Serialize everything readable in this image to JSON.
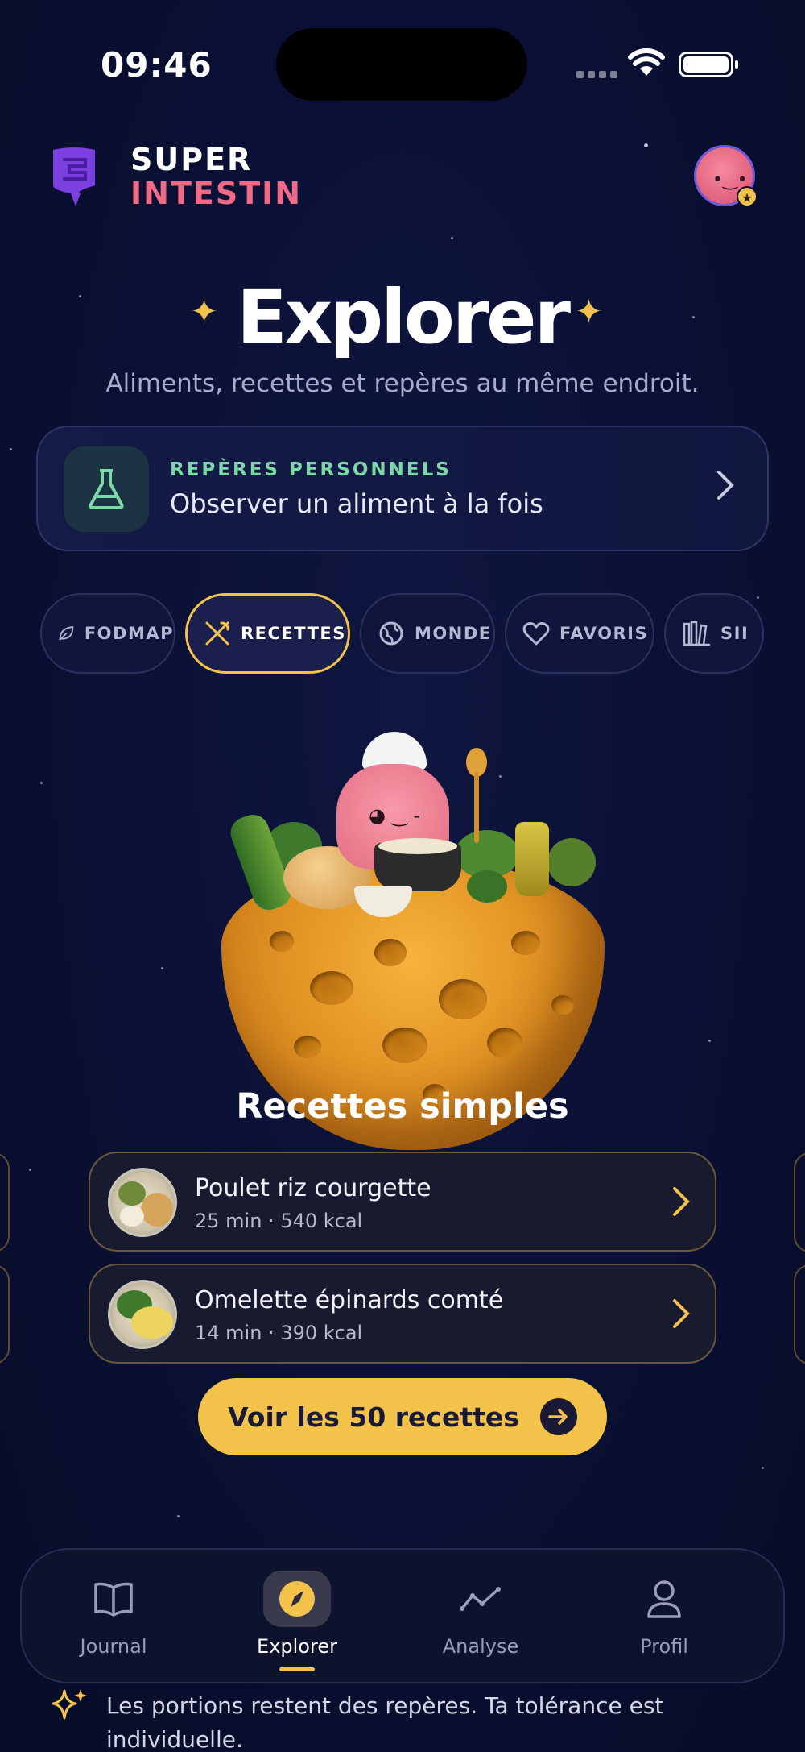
{
  "status_bar": {
    "time": "09:46"
  },
  "header": {
    "brand_line1": "SUPER",
    "brand_line2": "INTESTIN"
  },
  "hero": {
    "title": "Explorer",
    "subtitle": "Aliments, recettes et repères au même endroit."
  },
  "reperes_card": {
    "kicker": "REPÈRES PERSONNELS",
    "text": "Observer un aliment à la fois"
  },
  "tabs": [
    {
      "label": "FODMAP",
      "icon": "leaf-icon"
    },
    {
      "label": "RECETTES",
      "icon": "utensils-icon",
      "active": true
    },
    {
      "label": "MONDE",
      "icon": "globe-icon"
    },
    {
      "label": "FAVORIS",
      "icon": "heart-icon"
    },
    {
      "label": "SII",
      "icon": "books-icon"
    }
  ],
  "section": {
    "title": "Recettes simples"
  },
  "recipes": [
    {
      "name": "Poulet riz courgette",
      "meta": "25 min · 540 kcal"
    },
    {
      "name": "Omelette épinards comté",
      "meta": "14 min · 390 kcal"
    }
  ],
  "cta": {
    "label": "Voir les 50 recettes"
  },
  "nav": [
    {
      "label": "Journal",
      "icon": "book-icon"
    },
    {
      "label": "Explorer",
      "icon": "compass-icon",
      "active": true
    },
    {
      "label": "Analyse",
      "icon": "line-chart-icon"
    },
    {
      "label": "Profil",
      "icon": "user-icon"
    }
  ],
  "footer": {
    "text": "Les portions restent des repères. Ta tolérance est individuelle."
  },
  "colors": {
    "accent": "#f3c24a",
    "brand_pink": "#f06a86",
    "kicker_green": "#7ed7a9",
    "background": "#0a1033"
  }
}
